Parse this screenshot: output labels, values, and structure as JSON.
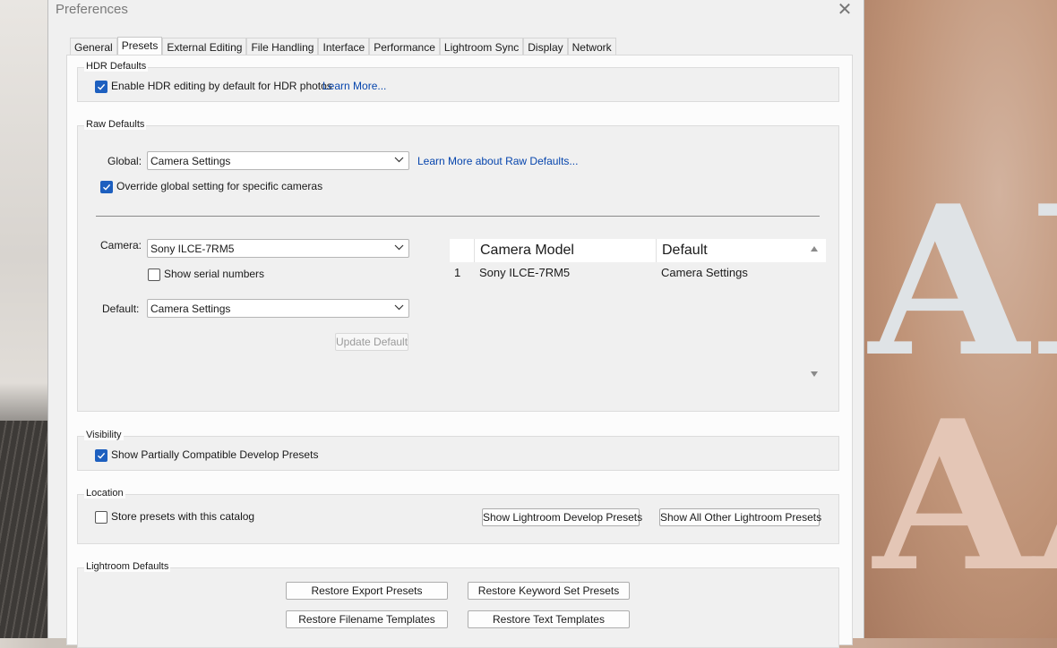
{
  "window": {
    "title": "Preferences",
    "close_glyph": "✕"
  },
  "tabs": [
    {
      "label": "General"
    },
    {
      "label": "Presets",
      "active": true
    },
    {
      "label": "External Editing"
    },
    {
      "label": "File Handling"
    },
    {
      "label": "Interface"
    },
    {
      "label": "Performance"
    },
    {
      "label": "Lightroom Sync"
    },
    {
      "label": "Display"
    },
    {
      "label": "Network"
    }
  ],
  "hdr": {
    "group_label": "HDR Defaults",
    "checkbox_label": "Enable HDR editing by default for HDR photos",
    "checked": true,
    "link": "Learn More..."
  },
  "raw": {
    "group_label": "Raw Defaults",
    "global_label": "Global:",
    "global_value": "Camera Settings",
    "link": "Learn More about Raw Defaults...",
    "override_label": "Override global setting for specific cameras",
    "override_checked": true,
    "camera_label": "Camera:",
    "camera_value": "Sony ILCE-7RM5",
    "serial_label": "Show serial numbers",
    "serial_checked": false,
    "default_label": "Default:",
    "default_value": "Camera Settings",
    "update_button": "Update Default",
    "table": {
      "headers": [
        "",
        "Camera Model",
        "Default"
      ],
      "rows": [
        {
          "index": "1",
          "model": "Sony ILCE-7RM5",
          "default": "Camera Settings"
        }
      ]
    }
  },
  "visibility": {
    "group_label": "Visibility",
    "checkbox_label": "Show Partially Compatible Develop Presets",
    "checked": true
  },
  "location": {
    "group_label": "Location",
    "checkbox_label": "Store presets with this catalog",
    "checked": false,
    "develop_button": "Show Lightroom Develop Presets",
    "other_button": "Show All Other Lightroom Presets"
  },
  "defaults": {
    "group_label": "Lightroom Defaults",
    "restore_export": "Restore Export Presets",
    "restore_keyword": "Restore Keyword Set Presets",
    "restore_filename": "Restore Filename Templates",
    "restore_text": "Restore Text Templates"
  },
  "colors": {
    "accent": "#1d5fbf",
    "link": "#0645ad"
  }
}
